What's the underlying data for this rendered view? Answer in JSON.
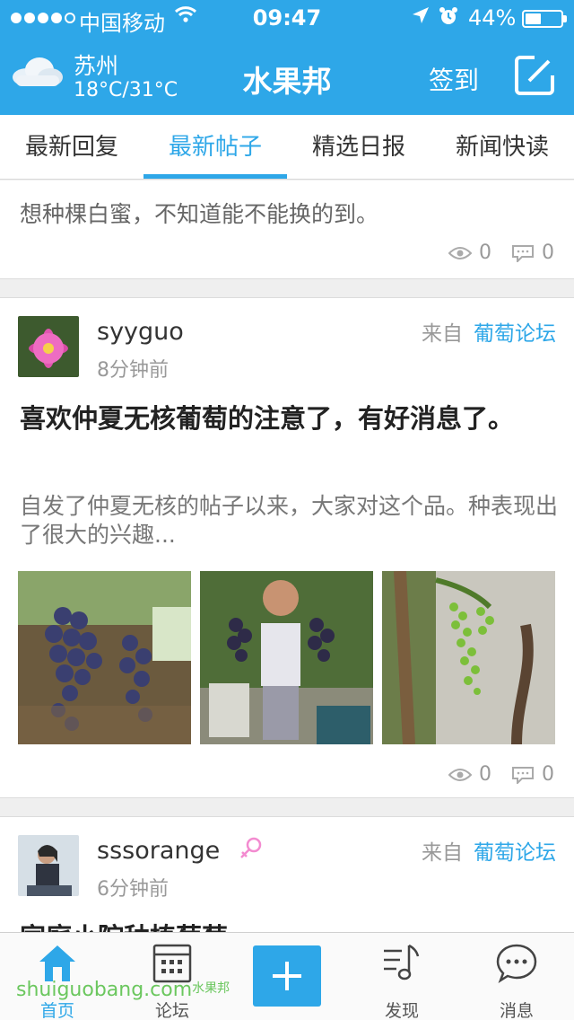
{
  "status_bar": {
    "carrier": "中国移动",
    "time": "09:47",
    "battery": "44%",
    "battery_level": 0.44
  },
  "header": {
    "city": "苏州",
    "temperature": "18°C/31°C",
    "title": "水果邦",
    "checkin_label": "签到",
    "weather_icon": "cloud-icon",
    "compose_icon": "compose-icon"
  },
  "tabs": [
    {
      "label": "最新回复",
      "active": false
    },
    {
      "label": "最新帖子",
      "active": true
    },
    {
      "label": "精选日报",
      "active": false
    },
    {
      "label": "新闻快读",
      "active": false
    }
  ],
  "feed": [
    {
      "excerpt": "想种棵白蜜，不知道能不能换的到。",
      "views": "0",
      "comments": "0"
    },
    {
      "username": "syyguo",
      "time_ago": "8分钟前",
      "from_label": "来自",
      "forum": "葡萄论坛",
      "title": "喜欢仲夏无核葡萄的注意了，有好消息了。",
      "excerpt": "自发了仲夏无核的帖子以来，大家对这个品。种表现出了很大的兴趣...",
      "views": "0",
      "comments": "0"
    },
    {
      "username": "sssorange",
      "time_ago": "6分钟前",
      "from_label": "来自",
      "forum": "葡萄论坛",
      "title": "家庭小院种植葡萄"
    }
  ],
  "tabbar": {
    "home": "首页",
    "forum": "论坛",
    "discover": "发现",
    "messages": "消息"
  },
  "watermark": {
    "text": "shuiguobang.com",
    "small": "水果邦"
  },
  "colors": {
    "accent": "#2ea7e8",
    "background": "#efefef"
  }
}
